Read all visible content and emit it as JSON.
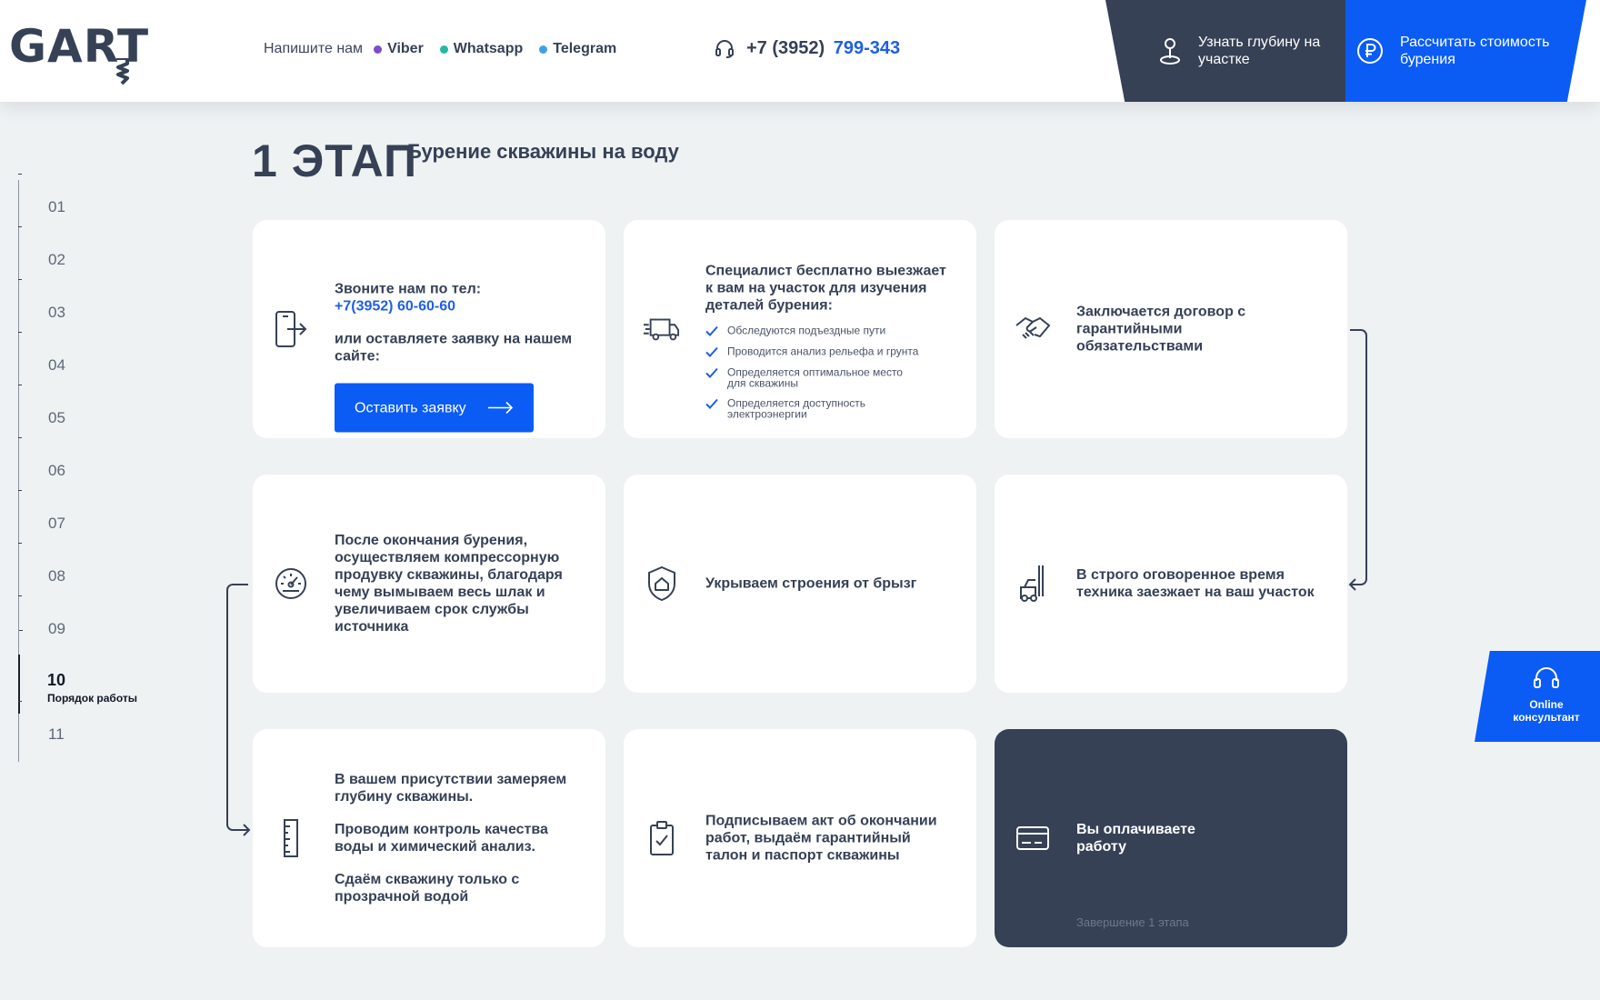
{
  "header": {
    "logo": "GART",
    "write_us": "Напишите нам",
    "messengers": [
      {
        "label": "Viber",
        "color": "#7d4cc9"
      },
      {
        "label": "Whatsapp",
        "color": "#25b7a5"
      },
      {
        "label": "Telegram",
        "color": "#3aa3e3"
      }
    ],
    "phone_code": "+7 (3952)",
    "phone_number": "799-343",
    "cta_depth": "Узнать глубину на участке",
    "cta_cost": "Рассчитать стоимость бурения"
  },
  "nav": {
    "items": [
      "01",
      "02",
      "03",
      "04",
      "05",
      "06",
      "07",
      "08",
      "09",
      "10",
      "11"
    ],
    "active_label": "Порядок работы"
  },
  "stage": {
    "title": "1 ЭТАП",
    "subtitle": "Бурение скважины на воду"
  },
  "cards": {
    "call": {
      "line1": "Звоните нам по тел:",
      "phone": "+7(3952) 60-60-60",
      "line2": "или оставляете заявку на нашем сайте:",
      "button": "Оставить заявку"
    },
    "specialist": {
      "text": "Специалист бесплатно выезжает к вам на участок для изучения деталей бурения:",
      "checklist": [
        "Обследуются подъездные пути",
        "Проводится анализ рельефа и грунта",
        "Определяется оптимальное место для скважины",
        "Определяется доступность электроэнергии"
      ]
    },
    "contract": {
      "text": "Заключается договор с гарантийными обязательствами"
    },
    "equipment": {
      "text": "В строго оговоренное время техника заезжает на ваш участок"
    },
    "shelter": {
      "text": "Укрываем строения от брызг"
    },
    "flush": {
      "text": "После окончания бурения, осуществляем компрессорную продувку скважины, благодаря чему вымываем весь шлак и увеличиваем срок службы источника"
    },
    "measure": {
      "p1": "В вашем присутствии замеряем глубину скважины.",
      "p2": "Проводим контроль качества воды и химический анализ.",
      "p3": "Сдаём скважину только с прозрачной водой"
    },
    "act": {
      "text": "Подписываем акт об окончании работ, выдаём гарантийный талон и паспорт скважины"
    },
    "payment": {
      "text": "Вы оплачиваете работу",
      "note": "Завершение 1 этапа"
    }
  },
  "online": {
    "label": "Online консультант"
  },
  "colors": {
    "accent": "#0a5cf5",
    "dark": "#364156",
    "background": "#eff2f3"
  }
}
